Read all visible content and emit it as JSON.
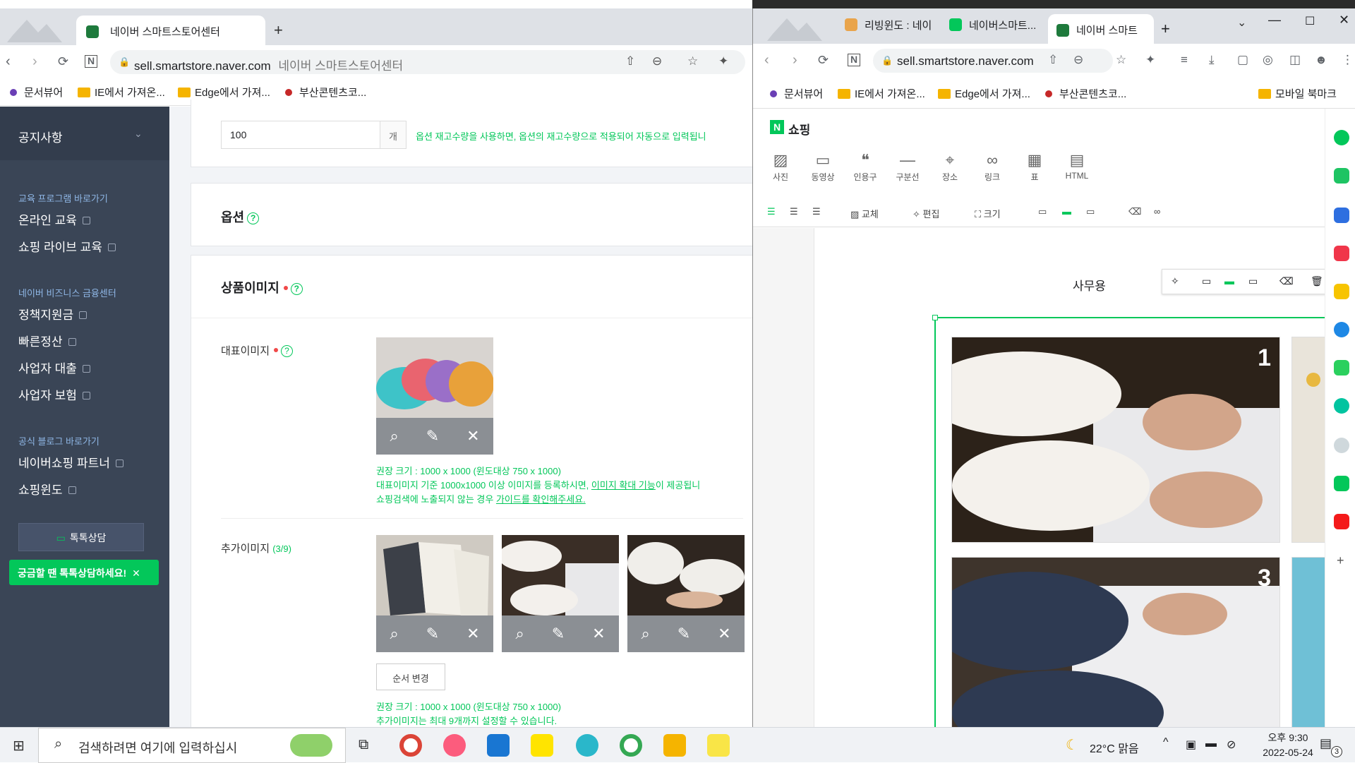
{
  "left_browser": {
    "tab_title": "네이버 스마트스토어센터",
    "url_domain": "sell.smartstore.naver.com",
    "url_title": "네이버 스마트스토어센터",
    "bookmarks": [
      "문서뷰어",
      "IE에서 가져온...",
      "Edge에서 가져...",
      "부산콘텐츠코..."
    ]
  },
  "sidebar": {
    "notice": "공지사항",
    "section1_title": "교육 프로그램 바로가기",
    "section1_items": [
      "온라인 교육",
      "쇼핑 라이브 교육"
    ],
    "section2_title": "네이버 비즈니스 금융센터",
    "section2_items": [
      "정책지원금",
      "빠른정산",
      "사업자 대출",
      "사업자 보험"
    ],
    "section3_title": "공식 블로그 바로가기",
    "section3_items": [
      "네이버쇼핑 파트너",
      "쇼핑윈도"
    ],
    "talk_button": "톡톡상담",
    "talk_tip": "궁금할 땐 톡톡상담하세요!"
  },
  "main": {
    "stock_value": "100",
    "stock_unit": "개",
    "stock_note": "옵션 재고수량을 사용하면, 옵션의 재고수량으로 적용되어 자동으로 입력됩니",
    "option_title": "옵션",
    "image_title": "상품이미지",
    "rep_image_label": "대표이미지",
    "rep_info_1": "권장 크기 : 1000 x 1000 (윈도대상 750 x 1000)",
    "rep_info_2a": "대표이미지 기준 1000x1000 이상 이미지를 등록하시면, ",
    "rep_info_2b": "이미지 확대 기능",
    "rep_info_2c": "이 제공됩니",
    "rep_info_3a": "쇼핑검색에 노출되지 않는 경우 ",
    "rep_info_3b": "가이드를 확인해주세요.",
    "add_image_label": "추가이미지",
    "add_image_count": "(3/9)",
    "order_button": "순서 변경",
    "add_info_1": "권장 크기 : 1000 x 1000 (윈도대상 750 x 1000)",
    "add_info_2": "추가이미지는 최대 9개까지 설정할 수 있습니다."
  },
  "right_browser": {
    "tabs": [
      "리빙윈도 : 네이",
      "네이버스마트...",
      "네이버 스마트"
    ],
    "url_domain": "sell.smartstore.naver.com",
    "bookmarks": [
      "문서뷰어",
      "IE에서 가져온...",
      "Edge에서 가져...",
      "부산콘텐츠코...",
      "모바일 북마크"
    ]
  },
  "editor": {
    "brand_letter": "N",
    "brand_name": "쇼핑",
    "toolbar": [
      "사진",
      "동영상",
      "인용구",
      "구분선",
      "장소",
      "링크",
      "표",
      "HTML"
    ],
    "toolbar_icons": [
      "image-icon",
      "video-icon",
      "quote-icon",
      "divider-icon",
      "place-icon",
      "link-icon",
      "table-icon",
      "html-icon"
    ],
    "format_replace": "교체",
    "format_edit": "편집",
    "format_size": "크기",
    "doc_text": "사무용 ",
    "photo_numbers": [
      "1",
      "3"
    ]
  },
  "taskbar": {
    "search_placeholder": "검색하려면 여기에 입력하십시",
    "weather": "22°C  맑음",
    "time": "오후 9:30",
    "date": "2022-05-24",
    "notifications": "3"
  }
}
